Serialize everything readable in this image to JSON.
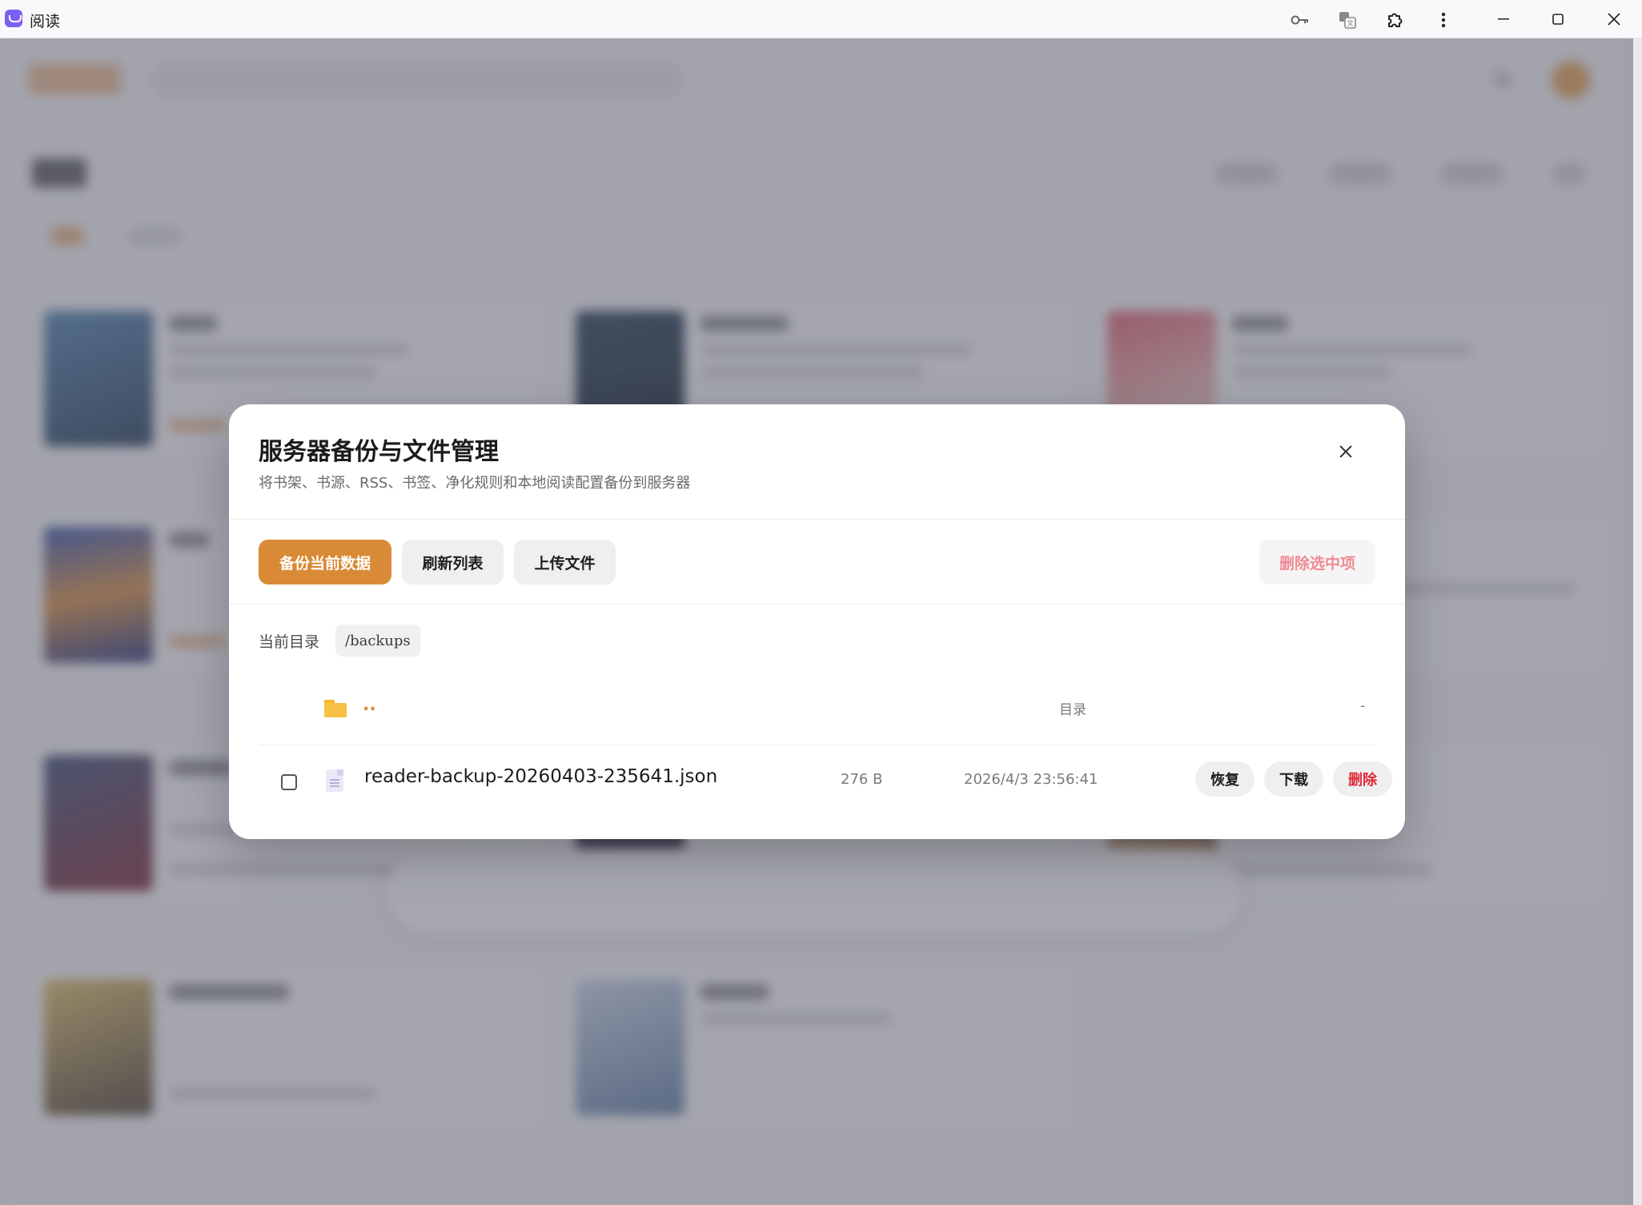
{
  "window": {
    "title": "阅读",
    "icons": [
      "key-icon",
      "translate-icon",
      "extension-icon",
      "more-vert-icon"
    ],
    "controls": [
      "minimize",
      "maximize",
      "close"
    ]
  },
  "dialog": {
    "title": "服务器备份与文件管理",
    "subtitle": "将书架、书源、RSS、书签、净化规则和本地阅读配置备份到服务器",
    "toolbar": {
      "backup_label": "备份当前数据",
      "refresh_label": "刷新列表",
      "upload_label": "上传文件",
      "delete_selected_label": "删除选中项"
    },
    "directory": {
      "label": "当前目录",
      "path": "/backups"
    },
    "parent_row": {
      "name": "..",
      "type": "目录",
      "modified": "-"
    },
    "files": [
      {
        "name": "reader-backup-20260403-235641.json",
        "size": "276 B",
        "modified": "2026/4/3 23:56:41",
        "checked": false,
        "actions": {
          "restore": "恢复",
          "download": "下载",
          "delete": "删除"
        }
      }
    ]
  },
  "colors": {
    "accent": "#d98a36",
    "danger": "#e02a36",
    "danger_soft": "#f08a93",
    "overlay": "#5c5f6e"
  }
}
